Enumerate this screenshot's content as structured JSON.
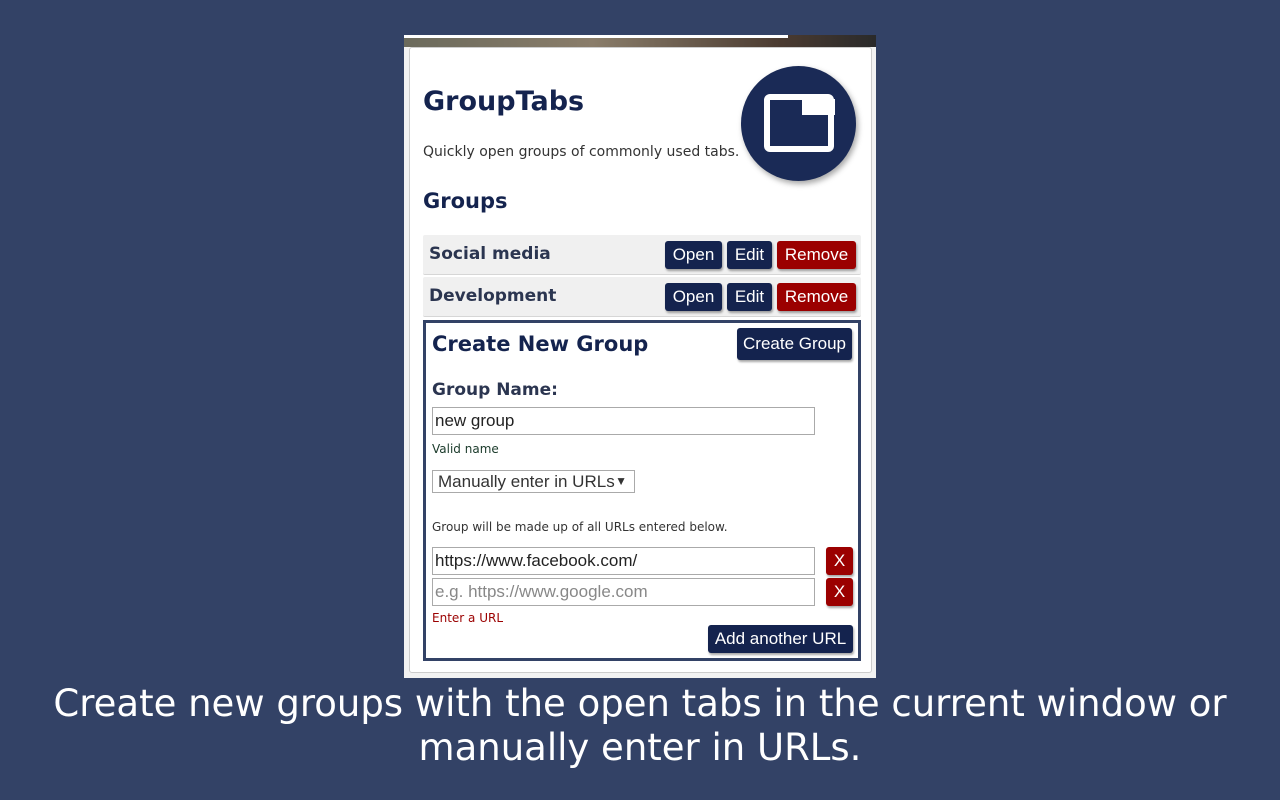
{
  "app": {
    "title": "GroupTabs",
    "description": "Quickly open groups of commonly used tabs.",
    "logo_icon": "tab-window-icon"
  },
  "groups": {
    "heading": "Groups",
    "items": [
      {
        "name": "Social media",
        "open": "Open",
        "edit": "Edit",
        "remove": "Remove"
      },
      {
        "name": "Development",
        "open": "Open",
        "edit": "Edit",
        "remove": "Remove"
      }
    ]
  },
  "create": {
    "heading": "Create New Group",
    "create_button": "Create Group",
    "name_label": "Group Name:",
    "name_value": "new group",
    "name_status": "Valid name",
    "mode_select": "Manually enter in URLs",
    "mode_arrow": "▼",
    "mode_hint": "Group will be made up of all URLs entered below.",
    "urls": [
      {
        "value": "https://www.facebook.com/",
        "placeholder": "e.g. https://www.google.com",
        "remove": "X"
      },
      {
        "value": "",
        "placeholder": "e.g. https://www.google.com",
        "remove": "X"
      }
    ],
    "url_error": "Enter a URL",
    "add_url_button": "Add another URL"
  },
  "caption": "Create new groups with the open tabs in the current window or manually enter in URLs.",
  "colors": {
    "background": "#334266",
    "primary": "#14234e",
    "danger": "#9b0000"
  }
}
